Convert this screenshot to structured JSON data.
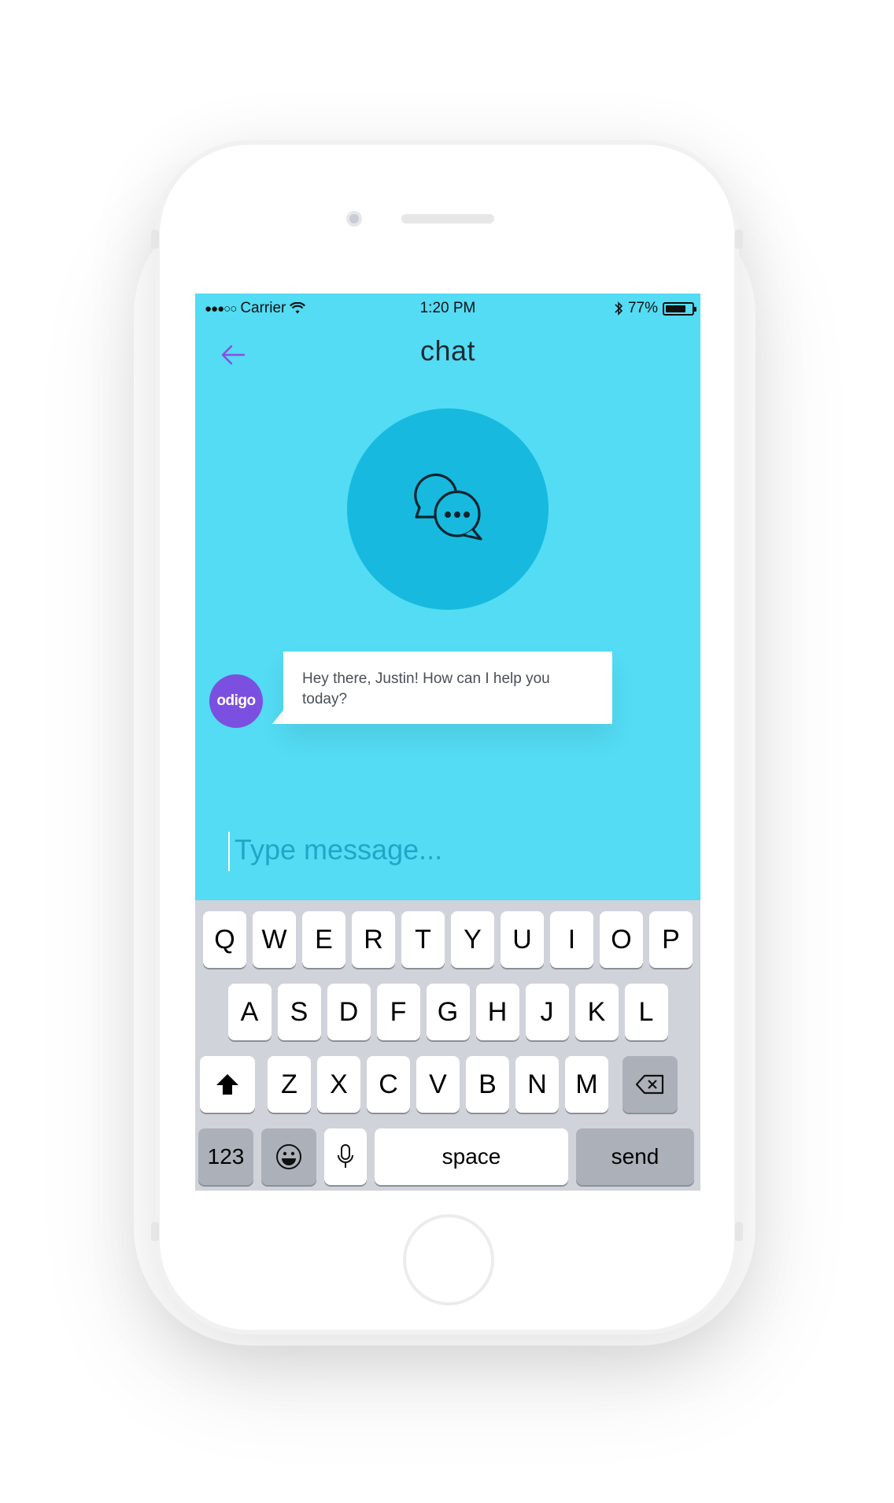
{
  "status": {
    "carrier": "Carrier",
    "time": "1:20 PM",
    "battery": "77%",
    "battery_level": 0.77
  },
  "nav": {
    "title": "chat",
    "back_icon": "arrow-left-icon"
  },
  "hero": {
    "icon": "chat-bubbles-icon"
  },
  "message": {
    "avatar_label": "odigo",
    "text": "Hey there, Justin! How can I help you today?"
  },
  "composer": {
    "placeholder": "Type message..."
  },
  "keyboard": {
    "row1": [
      "Q",
      "W",
      "E",
      "R",
      "T",
      "Y",
      "U",
      "I",
      "O",
      "P"
    ],
    "row2": [
      "A",
      "S",
      "D",
      "F",
      "G",
      "H",
      "J",
      "K",
      "L"
    ],
    "row3": [
      "Z",
      "X",
      "C",
      "V",
      "B",
      "N",
      "M"
    ],
    "numbers_key": "123",
    "space_key": "space",
    "send_key": "send"
  },
  "colors": {
    "screen_bg": "#53dcf4",
    "hero_circle": "#17bade",
    "avatar": "#7b4fe0",
    "back_arrow": "#8a4fe0",
    "keyboard_bg": "#d0d3da"
  }
}
